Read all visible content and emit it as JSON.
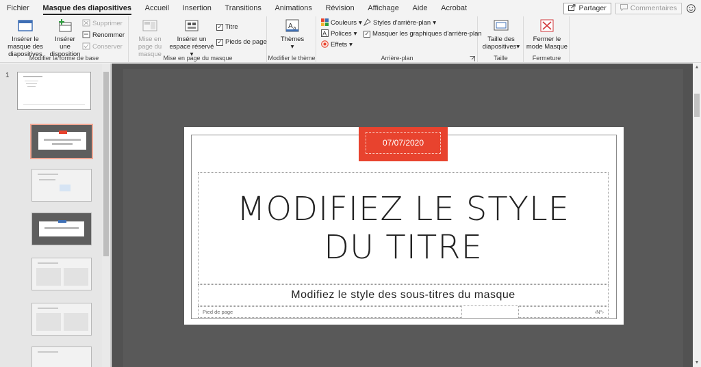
{
  "tabs": [
    "Fichier",
    "Masque des diapositives",
    "Accueil",
    "Insertion",
    "Transitions",
    "Animations",
    "Révision",
    "Affichage",
    "Aide",
    "Acrobat"
  ],
  "active_tab": "Masque des diapositives",
  "header_right": {
    "share": "Partager",
    "comments": "Commentaires"
  },
  "ribbon": {
    "group_base": {
      "label": "Modifier la forme de base",
      "insert_master": "Insérer le masque des diapositives",
      "insert_layout": "Insérer une disposition",
      "delete": "Supprimer",
      "rename": "Renommer",
      "preserve": "Conserver"
    },
    "group_layout": {
      "label": "Mise en page du masque",
      "master_layout": "Mise en page du masque",
      "insert_placeholder": "Insérer un espace réservé",
      "title": "Titre",
      "footers": "Pieds de page"
    },
    "group_theme": {
      "label": "Modifier le thème",
      "themes": "Thèmes"
    },
    "group_background": {
      "label": "Arrière-plan",
      "colors": "Couleurs",
      "fonts": "Polices",
      "effects": "Effets",
      "bg_styles": "Styles d'arrière-plan",
      "hide_bg": "Masquer les graphiques d'arrière-plan"
    },
    "group_size": {
      "label": "Taille",
      "slide_size": "Taille des diapositives"
    },
    "group_close": {
      "label": "Fermeture",
      "close_master": "Fermer le mode Masque"
    }
  },
  "thumbnails": {
    "master_number": "1"
  },
  "slide": {
    "date": "07/07/2020",
    "title_line1": "MODIFIEZ LE STYLE",
    "title_line2": "DU TITRE",
    "subtitle": "Modifiez le style des sous-titres du masque",
    "footer": "Pied de page",
    "number": "‹N°›"
  },
  "colors": {
    "accent": "#e8432e",
    "close_red": "#d13438"
  }
}
